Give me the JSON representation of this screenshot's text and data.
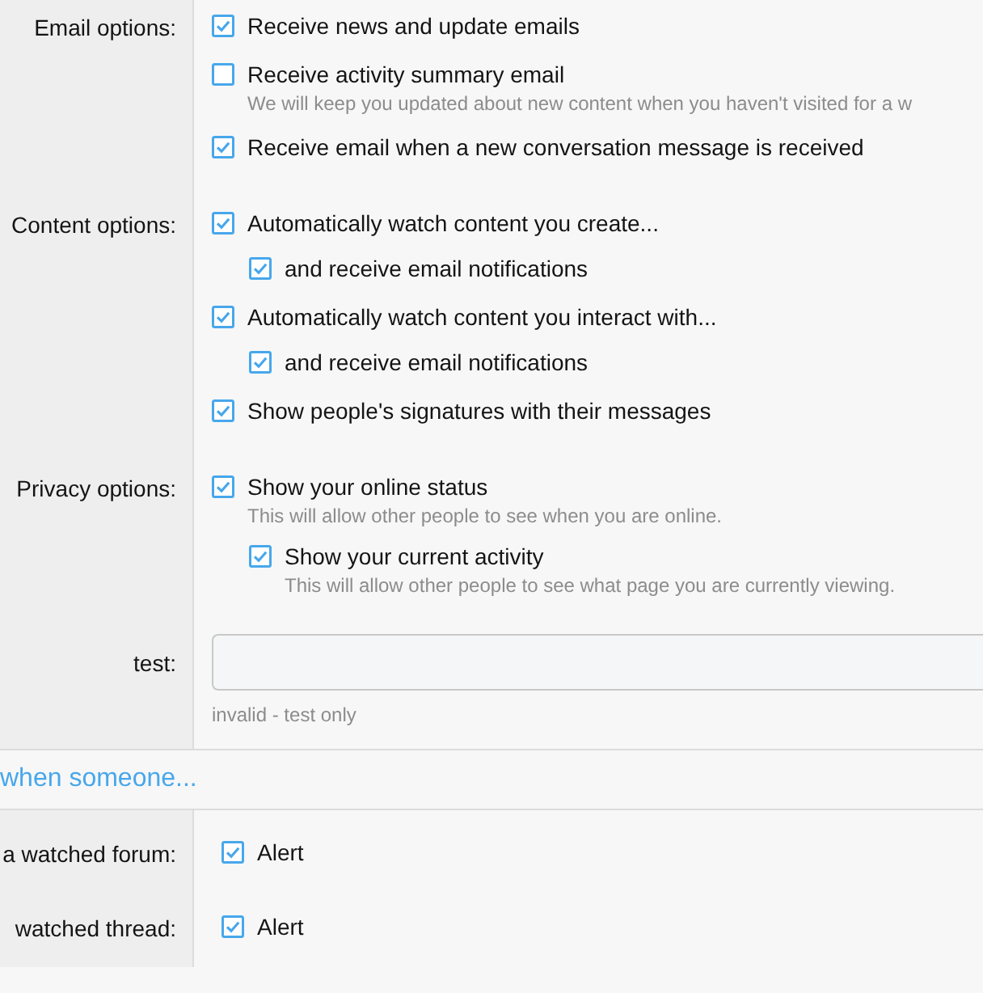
{
  "preferences": [
    {
      "label": "Email options:",
      "options": [
        {
          "kind": "checkbox",
          "checked": true,
          "text": "Receive news and update emails"
        },
        {
          "kind": "checkbox",
          "checked": false,
          "text": "Receive activity summary email",
          "hint": "We will keep you updated about new content when you haven't visited for a w"
        },
        {
          "kind": "checkbox",
          "checked": true,
          "text": "Receive email when a new conversation message is received"
        }
      ]
    },
    {
      "label": "Content options:",
      "options": [
        {
          "kind": "checkbox",
          "checked": true,
          "text": "Automatically watch content you create...",
          "children": [
            {
              "kind": "checkbox",
              "checked": true,
              "text": "and receive email notifications"
            }
          ]
        },
        {
          "kind": "checkbox",
          "checked": true,
          "text": "Automatically watch content you interact with...",
          "children": [
            {
              "kind": "checkbox",
              "checked": true,
              "text": "and receive email notifications"
            }
          ]
        },
        {
          "kind": "checkbox",
          "checked": true,
          "text": "Show people's signatures with their messages"
        }
      ]
    },
    {
      "label": "Privacy options:",
      "options": [
        {
          "kind": "checkbox",
          "checked": true,
          "text": "Show your online status",
          "hint": "This will allow other people to see when you are online.",
          "children": [
            {
              "kind": "checkbox",
              "checked": true,
              "text": "Show your current activity",
              "hint": "This will allow other people to see what page you are currently viewing."
            }
          ]
        }
      ]
    },
    {
      "label": "test:",
      "options": [
        {
          "kind": "field",
          "hint": "invalid - test only"
        }
      ]
    }
  ],
  "alerts_header": "when someone...",
  "alerts": [
    {
      "label": "a watched forum:",
      "options": [
        {
          "kind": "checkbox",
          "checked": true,
          "text": "Alert"
        }
      ]
    },
    {
      "label": "watched thread:",
      "options": [
        {
          "kind": "checkbox",
          "checked": true,
          "text": "Alert"
        }
      ]
    }
  ]
}
